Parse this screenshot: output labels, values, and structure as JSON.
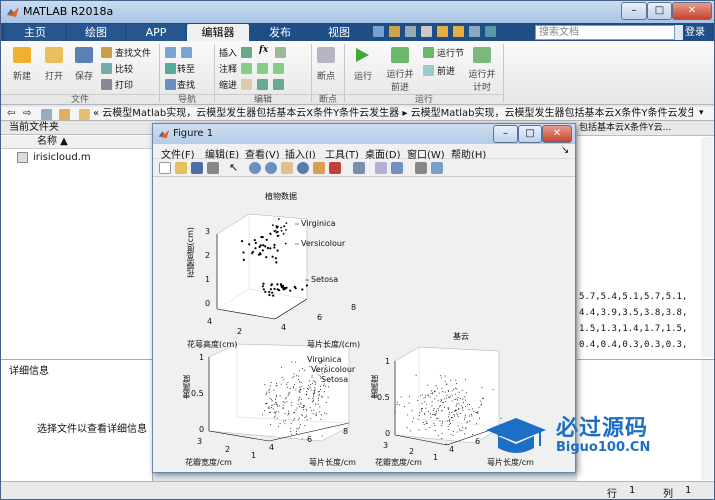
{
  "window": {
    "title": "MATLAB R2018a"
  },
  "tabs": [
    {
      "label": "主页"
    },
    {
      "label": "绘图"
    },
    {
      "label": "APP"
    },
    {
      "label": "编辑器"
    },
    {
      "label": "发布"
    },
    {
      "label": "视图"
    }
  ],
  "search": {
    "placeholder": "搜索文档"
  },
  "login": "登录",
  "ribbon": {
    "file": {
      "new": "新建",
      "open": "打开",
      "save": "保存",
      "find_files": "查找文件",
      "compare": "比较",
      "print": "打印",
      "group": "文件"
    },
    "nav": {
      "goto": "转至",
      "find": "查找",
      "group": "导航"
    },
    "edit": {
      "insert": "插入",
      "fx": "fx",
      "comment": "注释",
      "indent": "缩进",
      "group": "编辑"
    },
    "breakpoints": {
      "bp": "断点",
      "group": "断点"
    },
    "run": {
      "run": "运行",
      "run_advance": "运行并\n前进",
      "run_section": "运行节",
      "advance": "前进",
      "run_time": "运行并\n计时",
      "group": "运行"
    }
  },
  "address": {
    "path": "« 云模型Matlab实现，云模型发生器包括基本云X条件Y条件云发生器 ▸ 云模型Matlab实现，云模型发生器包括基本云X条件Y条件云发生器 ▸"
  },
  "folder_panel": {
    "title": "当前文件夹",
    "column": "名称 ▲",
    "files": [
      "irisicloud.m"
    ]
  },
  "details_panel": {
    "title": "详细信息",
    "hint": "选择文件以查看详细信息"
  },
  "editor": {
    "tab_fragment": "包括基本云X条件Y云...",
    "lines": [
      "5.7,5.4,5.1,5.7,5.1,",
      "4.4,3.9,3.5,3.8,3.8,",
      "1.5,1.3,1.4,1.7,1.5,",
      "0.4,0.4,0.3,0.3,0.3,"
    ]
  },
  "status_bar": {
    "row_label": "行",
    "row_value": "1",
    "col_label": "列",
    "col_value": "1"
  },
  "figure": {
    "title": "Figure 1",
    "menu": [
      "文件(F)",
      "编辑(E)",
      "查看(V)",
      "插入(I)",
      "工具(T)",
      "桌面(D)",
      "窗口(W)",
      "帮助(H)"
    ],
    "plots": {
      "p1": {
        "title": "植物数据",
        "zlabel": "花瓣宽度(cm)",
        "ylabel": "花萼高度(cm)",
        "xlabel": "萼片长度/(cm)",
        "annot": [
          "Virginica",
          "Versicolour",
          "Setosa"
        ],
        "zticks": [
          "3",
          "2",
          "1",
          "0"
        ],
        "yticks": [
          "4",
          "2"
        ],
        "xticks": [
          "4",
          "6",
          "8"
        ]
      },
      "p2": {
        "zlabel": "隶属度",
        "ylabel": "花瓣宽度/cm",
        "xlabel": "萼片长度/cm",
        "annot": [
          "Virginica",
          "Versicolour",
          "Setosa"
        ],
        "zticks": [
          "1",
          "0.5",
          "0"
        ],
        "yticks": [
          "3",
          "2",
          "1"
        ],
        "xticks": [
          "4",
          "6",
          "8"
        ]
      },
      "p3": {
        "title": "基云",
        "zlabel": "隶属度",
        "ylabel": "花瓣宽度/cm",
        "xlabel": "萼片长度/cm",
        "zticks": [
          "1",
          "0.5",
          "0"
        ],
        "yticks": [
          "3",
          "2",
          "1"
        ],
        "xticks": [
          "4",
          "6",
          "8"
        ]
      }
    }
  },
  "watermark": {
    "title": "必过源码",
    "url": "Biguo100.CN"
  },
  "colors": {
    "tab_bar": "#1f4e86",
    "figure_bg": "#f0f0f0",
    "title_bar": "#b4cbe8"
  }
}
